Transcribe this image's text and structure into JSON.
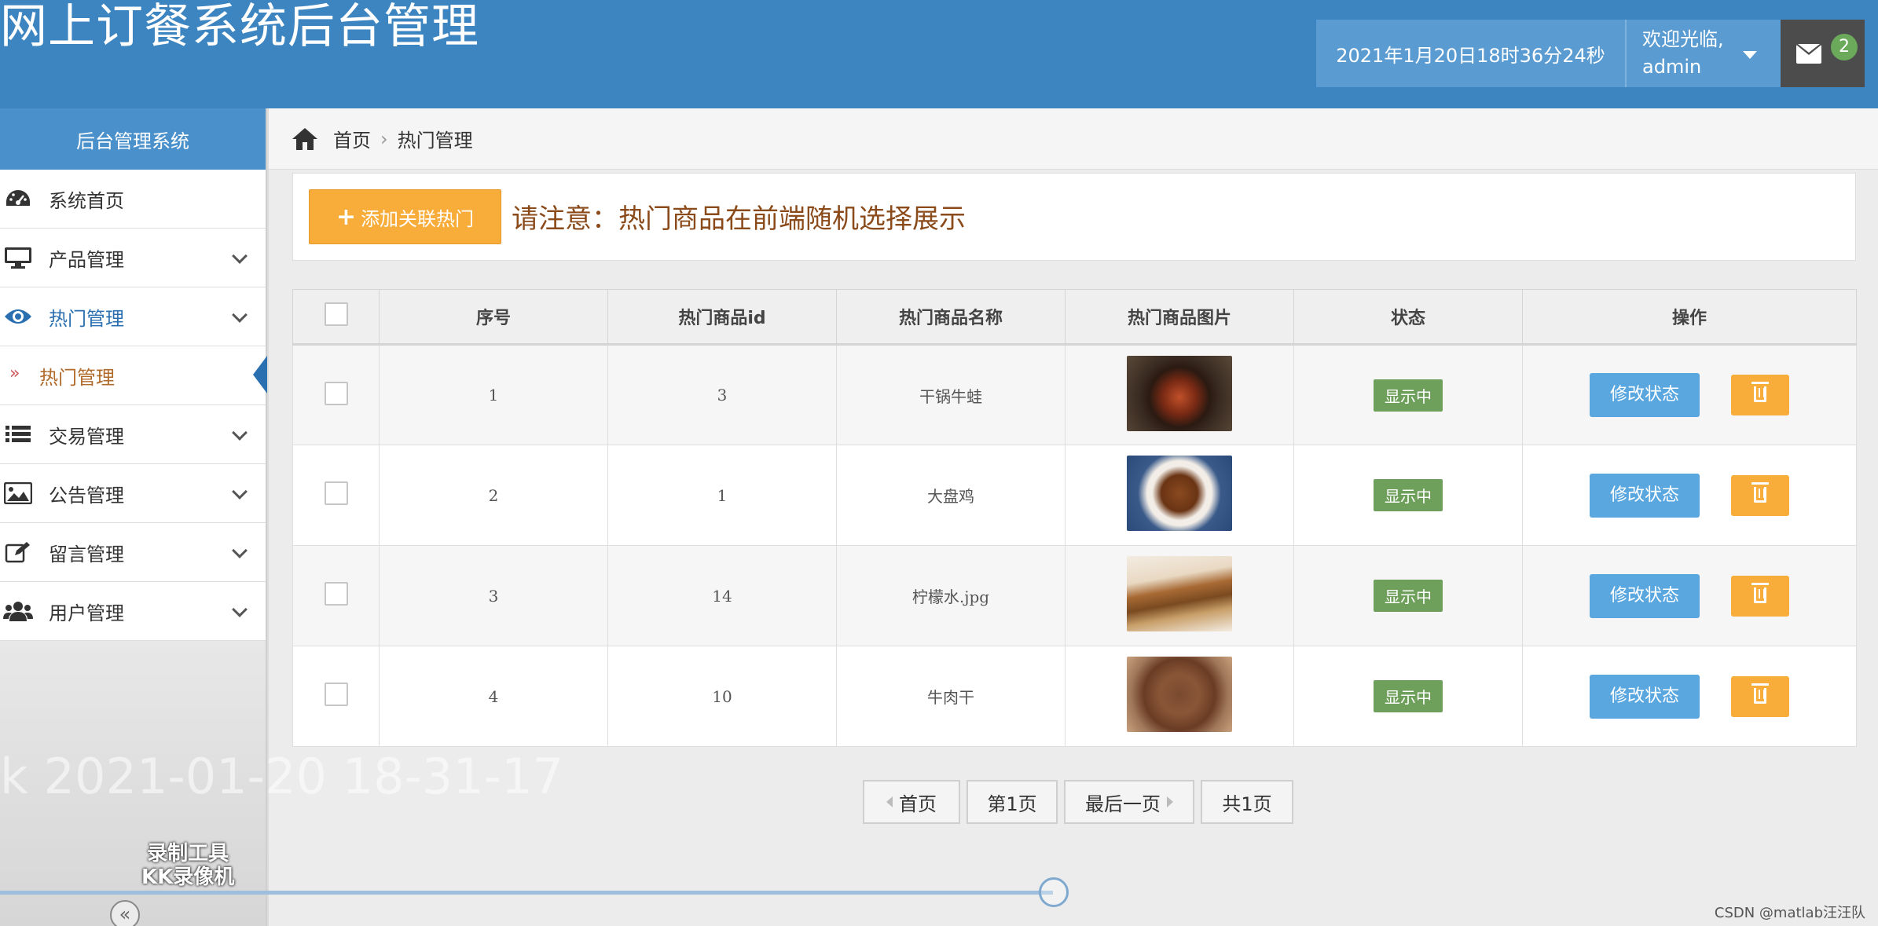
{
  "header": {
    "title": "网上订餐系统后台管理",
    "datetime": "2021年1月20日18时36分24秒",
    "welcome": "欢迎光临,",
    "username": "admin",
    "mail_count": "2"
  },
  "sidebar": {
    "title": "后台管理系统",
    "items": [
      {
        "label": "系统首页",
        "icon": "dashboard-icon"
      },
      {
        "label": "产品管理",
        "icon": "monitor-icon"
      },
      {
        "label": "热门管理",
        "icon": "eye-icon",
        "active": true
      },
      {
        "label": "交易管理",
        "icon": "list-icon"
      },
      {
        "label": "公告管理",
        "icon": "image-icon"
      },
      {
        "label": "留言管理",
        "icon": "edit-icon"
      },
      {
        "label": "用户管理",
        "icon": "users-icon"
      }
    ],
    "submenu": {
      "label": "热门管理"
    }
  },
  "breadcrumb": {
    "home": "首页",
    "current": "热门管理"
  },
  "toolbar": {
    "add_label": "添加关联热门",
    "notice": "请注意：热门商品在前端随机选择展示"
  },
  "table": {
    "headers": [
      "序号",
      "热门商品id",
      "热门商品名称",
      "热门商品图片",
      "状态",
      "操作"
    ],
    "rows": [
      {
        "index": "1",
        "product_id": "3",
        "name": "干锅牛蛙",
        "status": "显示中"
      },
      {
        "index": "2",
        "product_id": "1",
        "name": "大盘鸡",
        "status": "显示中"
      },
      {
        "index": "3",
        "product_id": "14",
        "name": "柠檬水.jpg",
        "status": "显示中"
      },
      {
        "index": "4",
        "product_id": "10",
        "name": "牛肉干",
        "status": "显示中"
      }
    ],
    "edit_label": "修改状态"
  },
  "pagination": {
    "first": "首页",
    "current": "第1页",
    "last": "最后一页",
    "total": "共1页"
  },
  "overlay": {
    "timestamp": "k 2021-01-20 18-31-17",
    "recorder_line1": "录制工具",
    "recorder_line2": "KK录像机",
    "watermark": "CSDN @matlab汪汪队",
    "rewind": "«"
  },
  "colors": {
    "header_bg": "#3d85c0",
    "accent_orange": "#f8ad3a",
    "status_green": "#6ea05c",
    "button_blue": "#5aa7e0"
  }
}
